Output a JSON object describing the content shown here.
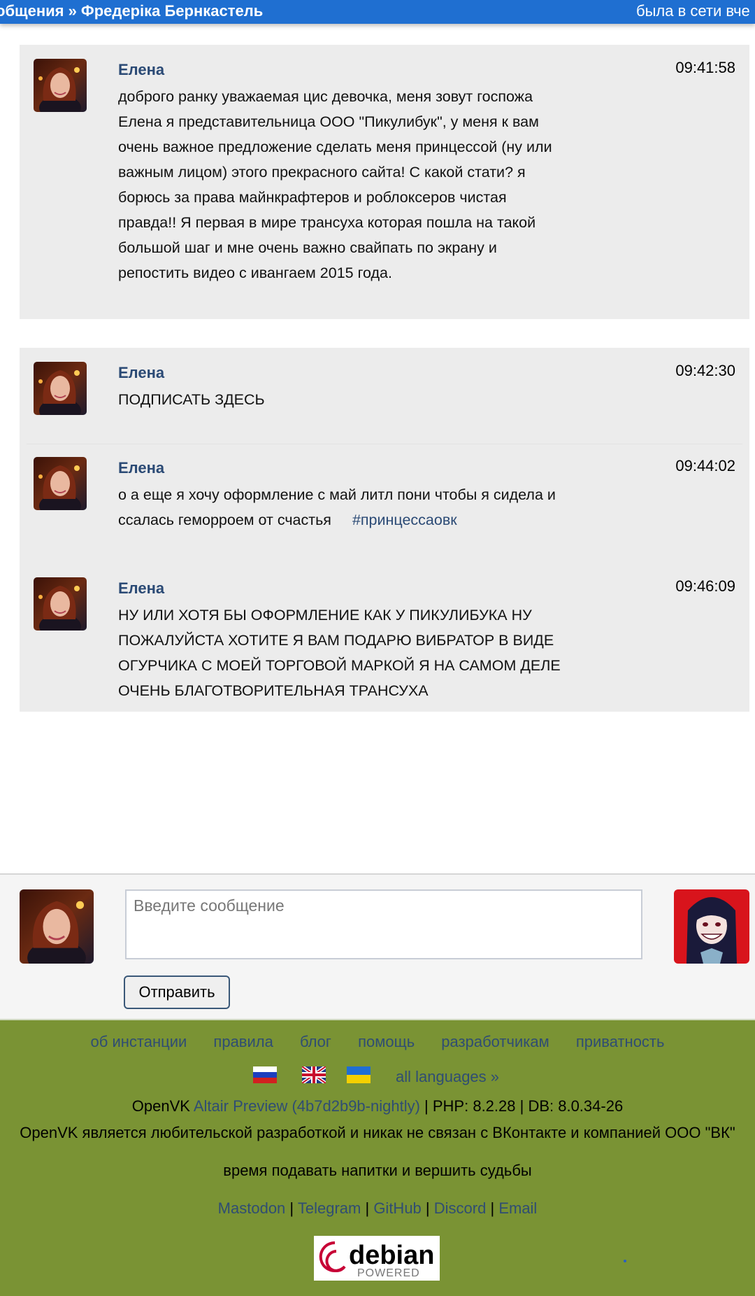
{
  "header": {
    "breadcrumb": "общения » Фредеріка Бернкастель",
    "status": "была в сети вче"
  },
  "messages": [
    {
      "author": "Елена",
      "time": "09:41:58",
      "text": "доброго ранку уважаемая цис девочка, меня зовут госпожа Елена я представительница ООО \"Пикулибук\", у меня к вам очень важное предложение сделать меня принцессой (ну или важным лицом) этого прекрасного сайта! С какой стати? я борюсь за права майнкрафтеров и роблоксеров чистая правда!! Я первая в мире трансуха которая пошла на такой большой шаг и мне очень важно свайпать по экрану и репостить видео с ивангаем 2015 года."
    },
    {
      "author": "Елена",
      "time": "09:42:30",
      "text": "ПОДПИСАТЬ ЗДЕСЬ"
    },
    {
      "author": "Елена",
      "time": "09:44:02",
      "text": "о а еще я хочу оформление с май литл пони чтобы я сидела и ссалась геморроем от счастья",
      "hashtag": "#принцессаовк"
    },
    {
      "author": "Елена",
      "time": "09:46:09",
      "text": "НУ ИЛИ ХОТЯ БЫ ОФОРМЛЕНИЕ КАК У ПИКУЛИБУКА НУ ПОЖАЛУЙСТА ХОТИТЕ Я ВАМ ПОДАРЮ ВИБРАТОР В ВИДЕ ОГУРЧИКА С МОЕЙ ТОРГОВОЙ МАРКОЙ Я НА САМОМ ДЕЛЕ ОЧЕНЬ БЛАГОТВОРИТЕЛЬНАЯ ТРАНСУХА"
    }
  ],
  "compose": {
    "placeholder": "Введите сообщение",
    "send_label": "Отправить"
  },
  "footer": {
    "links": [
      "об инстанции",
      "правила",
      "блог",
      "помощь",
      "разработчикам",
      "приватность"
    ],
    "flags": [
      "russia-flag-icon",
      "uk-flag-icon",
      "ukraine-flag-icon"
    ],
    "all_languages": "all languages »",
    "version_prefix": "OpenVK",
    "version_link": "Altair Preview (4b7d2b9b-nightly)",
    "version_suffix": "| PHP: 8.2.28 | DB: 8.0.34-26",
    "disclaimer": "OpenVK является любительской разработкой и никак не связан с ВКонтакте и компанией ООО \"ВК\"",
    "motto": "время подавать напитки и вершить судьбы",
    "social": [
      "Mastodon",
      "Telegram",
      "GitHub",
      "Discord",
      "Email"
    ],
    "social_separator": "|",
    "badge_word": "debian",
    "badge_sub": "POWERED"
  },
  "colors": {
    "header_bg": "#1f6fd1",
    "message_bg": "#ececec",
    "author": "#2b4a75",
    "footer_bg": "#7a9334",
    "link": "#2f4d73"
  }
}
